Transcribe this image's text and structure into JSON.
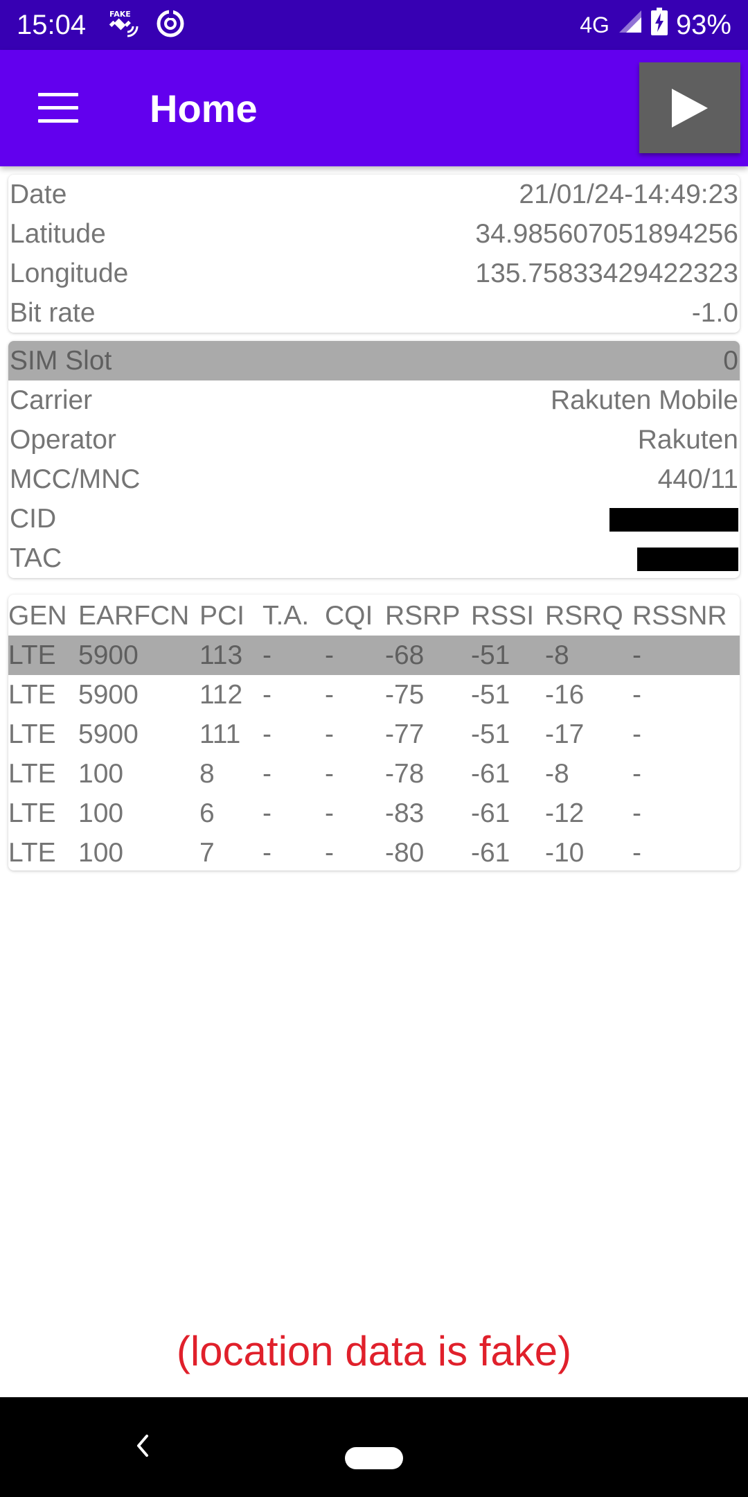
{
  "status_bar": {
    "time": "15:04",
    "network": "4G",
    "battery": "93%",
    "icons": [
      "fake-gps-icon",
      "sync-icon",
      "signal-icon",
      "battery-charging-icon"
    ]
  },
  "app_bar": {
    "title": "Home",
    "icons": [
      "menu-icon",
      "play-icon"
    ]
  },
  "location": {
    "rows": [
      {
        "label": "Date",
        "value": "21/01/24-14:49:23"
      },
      {
        "label": "Latitude",
        "value": "34.985607051894256"
      },
      {
        "label": "Longitude",
        "value": "135.75833429422323"
      },
      {
        "label": "Bit rate",
        "value": "-1.0"
      }
    ]
  },
  "sim": {
    "slot": {
      "label": "SIM Slot",
      "value": "0"
    },
    "rows": [
      {
        "label": "Carrier",
        "value": "Rakuten Mobile"
      },
      {
        "label": "Operator",
        "value": "Rakuten"
      },
      {
        "label": "MCC/MNC",
        "value": "440/11"
      },
      {
        "label": "CID",
        "value": ""
      },
      {
        "label": "TAC",
        "value": ""
      }
    ]
  },
  "cells": {
    "headers": [
      "GEN",
      "EARFCN",
      "PCI",
      "T.A.",
      "CQI",
      "RSRP",
      "RSSI",
      "RSRQ",
      "RSSNR"
    ],
    "rows": [
      [
        "LTE",
        "5900",
        "113",
        "-",
        "-",
        "-68",
        "-51",
        "-8",
        "-"
      ],
      [
        "LTE",
        "5900",
        "112",
        "-",
        "-",
        "-75",
        "-51",
        "-16",
        "-"
      ],
      [
        "LTE",
        "5900",
        "111",
        "-",
        "-",
        "-77",
        "-51",
        "-17",
        "-"
      ],
      [
        "LTE",
        "100",
        "8",
        "-",
        "-",
        "-78",
        "-61",
        "-8",
        "-"
      ],
      [
        "LTE",
        "100",
        "6",
        "-",
        "-",
        "-83",
        "-61",
        "-12",
        "-"
      ],
      [
        "LTE",
        "100",
        "7",
        "-",
        "-",
        "-80",
        "-61",
        "-10",
        "-"
      ]
    ]
  },
  "note": "(location data is fake)",
  "nav": {
    "icons": [
      "back-icon",
      "home-pill-icon"
    ]
  },
  "colors": {
    "status_bar": "#3700b3",
    "app_bar": "#6200ee",
    "play_button": "#5f5f5f",
    "highlight_row": "#aaaaaa",
    "note_text": "#e0202b"
  }
}
